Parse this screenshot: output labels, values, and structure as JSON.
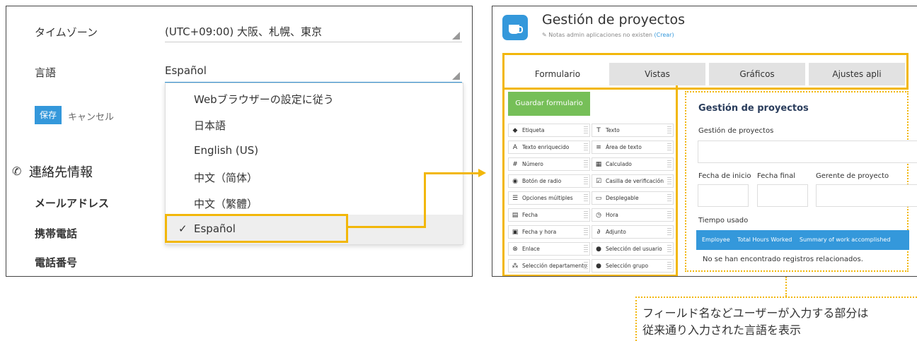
{
  "left_panel": {
    "timezone_label": "タイムゾーン",
    "timezone_value": "(UTC+09:00) 大阪、札幌、東京",
    "language_label": "言語",
    "language_value": "Español",
    "save_button": "保存",
    "cancel_link": "キャンセル",
    "contact_section_title": "連絡先情報",
    "email_label": "メールアドレス",
    "mobile_label": "携帯電話",
    "phone_label": "電話番号",
    "language_options": [
      "Webブラウザーの設定に従う",
      "日本語",
      "English (US)",
      "中文（简体）",
      "中文（繁體）",
      "Español"
    ],
    "selected_index": 5,
    "check_mark": "✓"
  },
  "right_panel": {
    "app_title": "Gestión de proyectos",
    "notes_text": "Notas admin aplicaciones no existen",
    "notes_link": "(Crear)",
    "tabs": [
      "Formulario",
      "Vistas",
      "Gráficos",
      "Ajustes apli"
    ],
    "save_form_button": "Guardar formulario",
    "palette": [
      {
        "label": "Etiqueta",
        "icon": "tag-icon"
      },
      {
        "label": "Texto",
        "icon": "text-icon"
      },
      {
        "label": "Texto enriquecido",
        "icon": "rich-text-icon"
      },
      {
        "label": "Área de texto",
        "icon": "textarea-icon"
      },
      {
        "label": "Número",
        "icon": "number-icon"
      },
      {
        "label": "Calculado",
        "icon": "calculator-icon"
      },
      {
        "label": "Botón de radio",
        "icon": "radio-icon"
      },
      {
        "label": "Casilla de verificación",
        "icon": "checkbox-icon"
      },
      {
        "label": "Opciones múltiples",
        "icon": "multi-choice-icon"
      },
      {
        "label": "Desplegable",
        "icon": "dropdown-icon"
      },
      {
        "label": "Fecha",
        "icon": "date-icon"
      },
      {
        "label": "Hora",
        "icon": "clock-icon"
      },
      {
        "label": "Fecha y hora",
        "icon": "datetime-icon"
      },
      {
        "label": "Adjunto",
        "icon": "paperclip-icon"
      },
      {
        "label": "Enlace",
        "icon": "link-icon"
      },
      {
        "label": "Selección del usuario",
        "icon": "user-icon"
      },
      {
        "label": "Selección departamento",
        "icon": "org-icon"
      },
      {
        "label": "Selección grupo",
        "icon": "group-icon"
      }
    ],
    "form": {
      "title": "Gestión de proyectos",
      "field1_label": "Gestión de proyectos",
      "start_date_label": "Fecha de inicio",
      "end_date_label": "Fecha final",
      "manager_label": "Gerente de proyecto",
      "time_used_label": "Tiempo usado",
      "table_columns": [
        "Employee",
        "Total Hours Worked",
        "Summary of work accomplished"
      ],
      "empty_message": "No se han encontrado registros relacionados."
    }
  },
  "annotation": {
    "line1": "フィールド名などユーザーが入力する部分は",
    "line2": "従来通り入力された言語を表示"
  },
  "colors": {
    "accent": "#3498db",
    "highlight": "#f2b70a",
    "green": "#76bf58"
  }
}
